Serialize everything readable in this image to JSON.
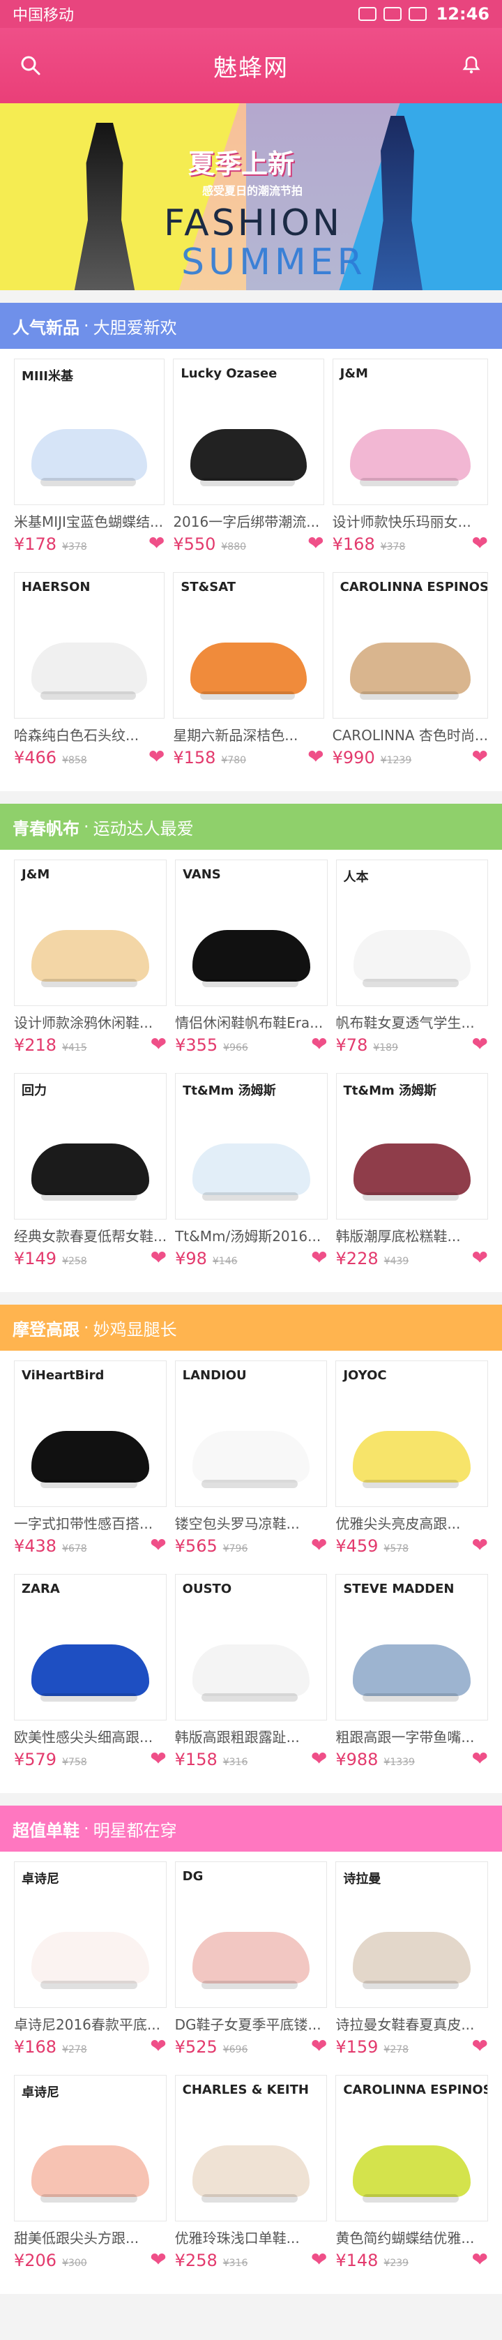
{
  "status_bar": {
    "carrier": "中国移动",
    "time": "12:46"
  },
  "header": {
    "title": "魅蜂网",
    "search_icon": "search-icon",
    "bell_icon": "bell-icon"
  },
  "banner": {
    "headline": "夏季上新",
    "subtitle": "感受夏日的潮流节拍",
    "fashion": "FASHION",
    "summer": "SUMMER"
  },
  "sections": [
    {
      "title": "人气新品",
      "subtitle": "大胆爱新欢",
      "color": "#6f90ea",
      "products": [
        {
          "brand": "MIII米基",
          "name": "米基MIJI宝蓝色蝴蝶结...",
          "price": "¥178",
          "old_price": "¥378",
          "shoe_color": "#d6e4f7"
        },
        {
          "brand": "Lucky Ozasee",
          "name": "2016一字后绑带潮流...",
          "price": "¥550",
          "old_price": "¥880",
          "shoe_color": "#222222"
        },
        {
          "brand": "J&M",
          "name": "设计师款快乐玛丽女...",
          "price": "¥168",
          "old_price": "¥378",
          "shoe_color": "#f2b7d3"
        },
        {
          "brand": "HAERSON",
          "name": "哈森纯白色石头纹...",
          "price": "¥466",
          "old_price": "¥858",
          "shoe_color": "#f0f0f0"
        },
        {
          "brand": "ST&SAT",
          "name": "星期六新品深桔色...",
          "price": "¥158",
          "old_price": "¥780",
          "shoe_color": "#f08b3b"
        },
        {
          "brand": "CAROLINNA ESPINOSA",
          "name": "CAROLINNA 杏色时尚...",
          "price": "¥990",
          "old_price": "¥1239",
          "shoe_color": "#d9b58e"
        }
      ]
    },
    {
      "title": "青春帆布",
      "subtitle": "运动达人最爱",
      "color": "#8fd06b",
      "products": [
        {
          "brand": "J&M",
          "name": "设计师款涂鸦休闲鞋...",
          "price": "¥218",
          "old_price": "¥415",
          "shoe_color": "#f3d6a6"
        },
        {
          "brand": "VANS",
          "name": "情侣休闲鞋帆布鞋Era...",
          "price": "¥355",
          "old_price": "¥966",
          "shoe_color": "#111111"
        },
        {
          "brand": "人本",
          "name": "帆布鞋女夏透气学生...",
          "price": "¥78",
          "old_price": "¥189",
          "shoe_color": "#f5f5f5"
        },
        {
          "brand": "回力",
          "name": "经典女款春夏低帮女鞋...",
          "price": "¥149",
          "old_price": "¥258",
          "shoe_color": "#1b1b1b"
        },
        {
          "brand": "Tt&Mm 汤姆斯",
          "name": "Tt&Mm/汤姆斯2016...",
          "price": "¥98",
          "old_price": "¥146",
          "shoe_color": "#e2eef8"
        },
        {
          "brand": "Tt&Mm 汤姆斯",
          "name": "韩版潮厚底松糕鞋...",
          "price": "¥228",
          "old_price": "¥439",
          "shoe_color": "#8f3d4a"
        }
      ]
    },
    {
      "title": "摩登高跟",
      "subtitle": "妙鸡显腿长",
      "color": "#ffb44f",
      "products": [
        {
          "brand": "ViHeartBird",
          "name": "一字式扣带性感百搭...",
          "price": "¥438",
          "old_price": "¥678",
          "shoe_color": "#111111"
        },
        {
          "brand": "LANDIOU",
          "name": "镂空包头罗马凉鞋...",
          "price": "¥565",
          "old_price": "¥796",
          "shoe_color": "#f8f8f8"
        },
        {
          "brand": "JOYOC",
          "name": "优雅尖头亮皮高跟...",
          "price": "¥459",
          "old_price": "¥578",
          "shoe_color": "#f7e46a"
        },
        {
          "brand": "ZARA",
          "name": "欧美性感尖头细高跟...",
          "price": "¥579",
          "old_price": "¥758",
          "shoe_color": "#1e4fc2"
        },
        {
          "brand": "OUSTO",
          "name": "韩版高跟粗跟露趾...",
          "price": "¥158",
          "old_price": "¥316",
          "shoe_color": "#f4f4f4"
        },
        {
          "brand": "STEVE MADDEN",
          "name": "粗跟高跟一字带鱼嘴...",
          "price": "¥988",
          "old_price": "¥1339",
          "shoe_color": "#9db4d0"
        }
      ]
    },
    {
      "title": "超值单鞋",
      "subtitle": "明星都在穿",
      "color": "#ff77c0",
      "products": [
        {
          "brand": "卓诗尼",
          "name": "卓诗尼2016春款平底...",
          "price": "¥168",
          "old_price": "¥278",
          "shoe_color": "#fbf3f1"
        },
        {
          "brand": "DG",
          "name": "DG鞋子女夏季平底镂...",
          "price": "¥525",
          "old_price": "¥696",
          "shoe_color": "#f2c7c2"
        },
        {
          "brand": "诗拉曼",
          "name": "诗拉曼女鞋春夏真皮...",
          "price": "¥159",
          "old_price": "¥278",
          "shoe_color": "#e3d7ca"
        },
        {
          "brand": "卓诗尼",
          "name": "甜美低跟尖头方跟...",
          "price": "¥206",
          "old_price": "¥300",
          "shoe_color": "#f7c3b3"
        },
        {
          "brand": "CHARLES & KEITH",
          "name": "优雅玲珠浅口单鞋...",
          "price": "¥258",
          "old_price": "¥316",
          "shoe_color": "#efe2d4"
        },
        {
          "brand": "CAROLINNA ESPINOSA",
          "name": "黄色简约蝴蝶结优雅...",
          "price": "¥148",
          "old_price": "¥239",
          "shoe_color": "#d4e34c"
        }
      ]
    }
  ]
}
